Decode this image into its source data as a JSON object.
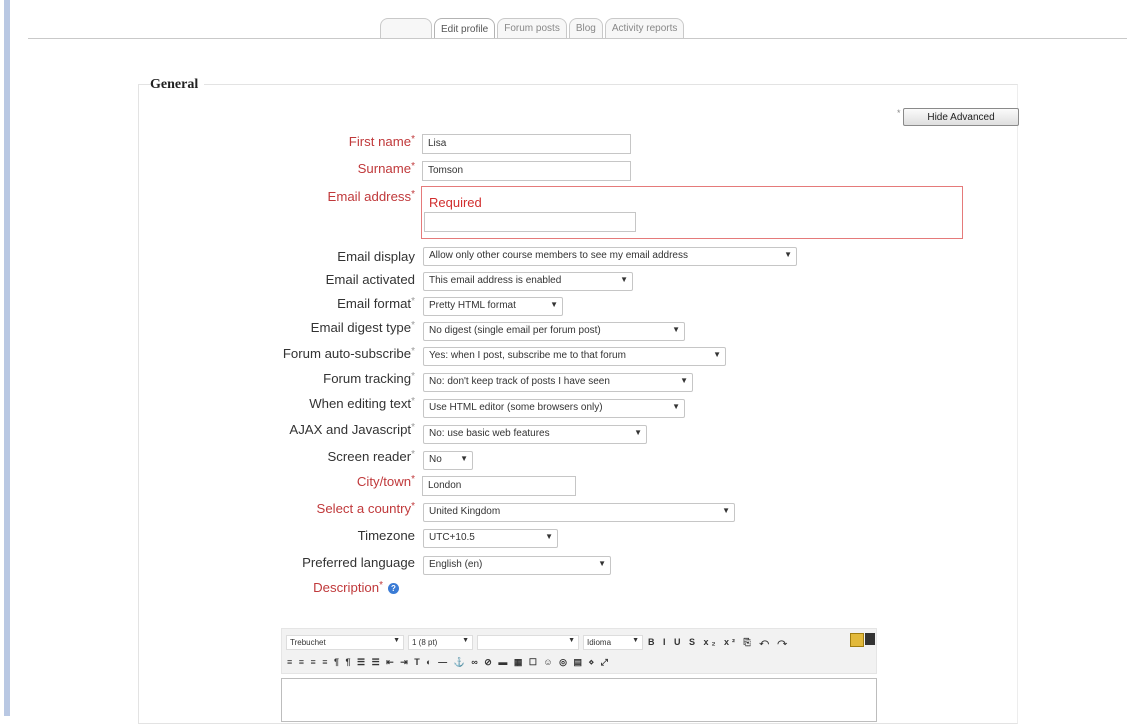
{
  "tabs": [
    {
      "label": ""
    },
    {
      "label": "Edit profile"
    },
    {
      "label": "Forum posts"
    },
    {
      "label": "Blog"
    },
    {
      "label": "Activity reports"
    }
  ],
  "section": {
    "legend": "General"
  },
  "advanced_button": {
    "label": "Hide Advanced",
    "star": "*"
  },
  "form": {
    "first_name": {
      "label": "First name",
      "value": "Lisa"
    },
    "surname": {
      "label": "Surname",
      "value": "Tomson"
    },
    "email_address": {
      "label": "Email address",
      "value": "",
      "error": "Required"
    },
    "email_display": {
      "label": "Email display",
      "value": "Allow only other course members to see my email address"
    },
    "email_activated": {
      "label": "Email activated",
      "value": "This email address is enabled"
    },
    "email_format": {
      "label": "Email format",
      "value": "Pretty HTML format"
    },
    "email_digest_type": {
      "label": "Email digest type",
      "value": "No digest (single email per forum post)"
    },
    "forum_auto_subscribe": {
      "label": "Forum auto-subscribe",
      "value": "Yes: when I post, subscribe me to that forum"
    },
    "forum_tracking": {
      "label": "Forum tracking",
      "value": "No: don't keep track of posts I have seen"
    },
    "when_editing_text": {
      "label": "When editing text",
      "value": "Use HTML editor (some browsers only)"
    },
    "ajax_javascript": {
      "label": "AJAX and Javascript",
      "value": "No: use basic web features"
    },
    "screen_reader": {
      "label": "Screen reader",
      "value": "No"
    },
    "city_town": {
      "label": "City/town",
      "value": "London"
    },
    "country": {
      "label": "Select a country",
      "value": "United Kingdom"
    },
    "timezone": {
      "label": "Timezone",
      "value": "UTC+10.5"
    },
    "preferred_language": {
      "label": "Preferred language",
      "value": "English (en)"
    },
    "description": {
      "label": "Description"
    }
  },
  "editor": {
    "font_family": "Trebuchet",
    "font_size": "1 (8 pt)",
    "style": "",
    "language": "Idioma",
    "row1_buttons": "B I U S x₂ x² ⎘ ↶ ↷",
    "row2_buttons": "≡ ≡ ≡ ≡ ¶ ¶ ☰ ☰ ⇤ ⇥ T ◐ — ⚓ ∞ ⊘ ▬ ▦ ☐ ☺ ◎ ▤ ⋄ ⤢"
  },
  "colors": {
    "required": "#c0393b",
    "error_border": "#e57a7a"
  },
  "icons": {
    "help": "help-icon",
    "select_arrow": "chevron-down-icon"
  }
}
